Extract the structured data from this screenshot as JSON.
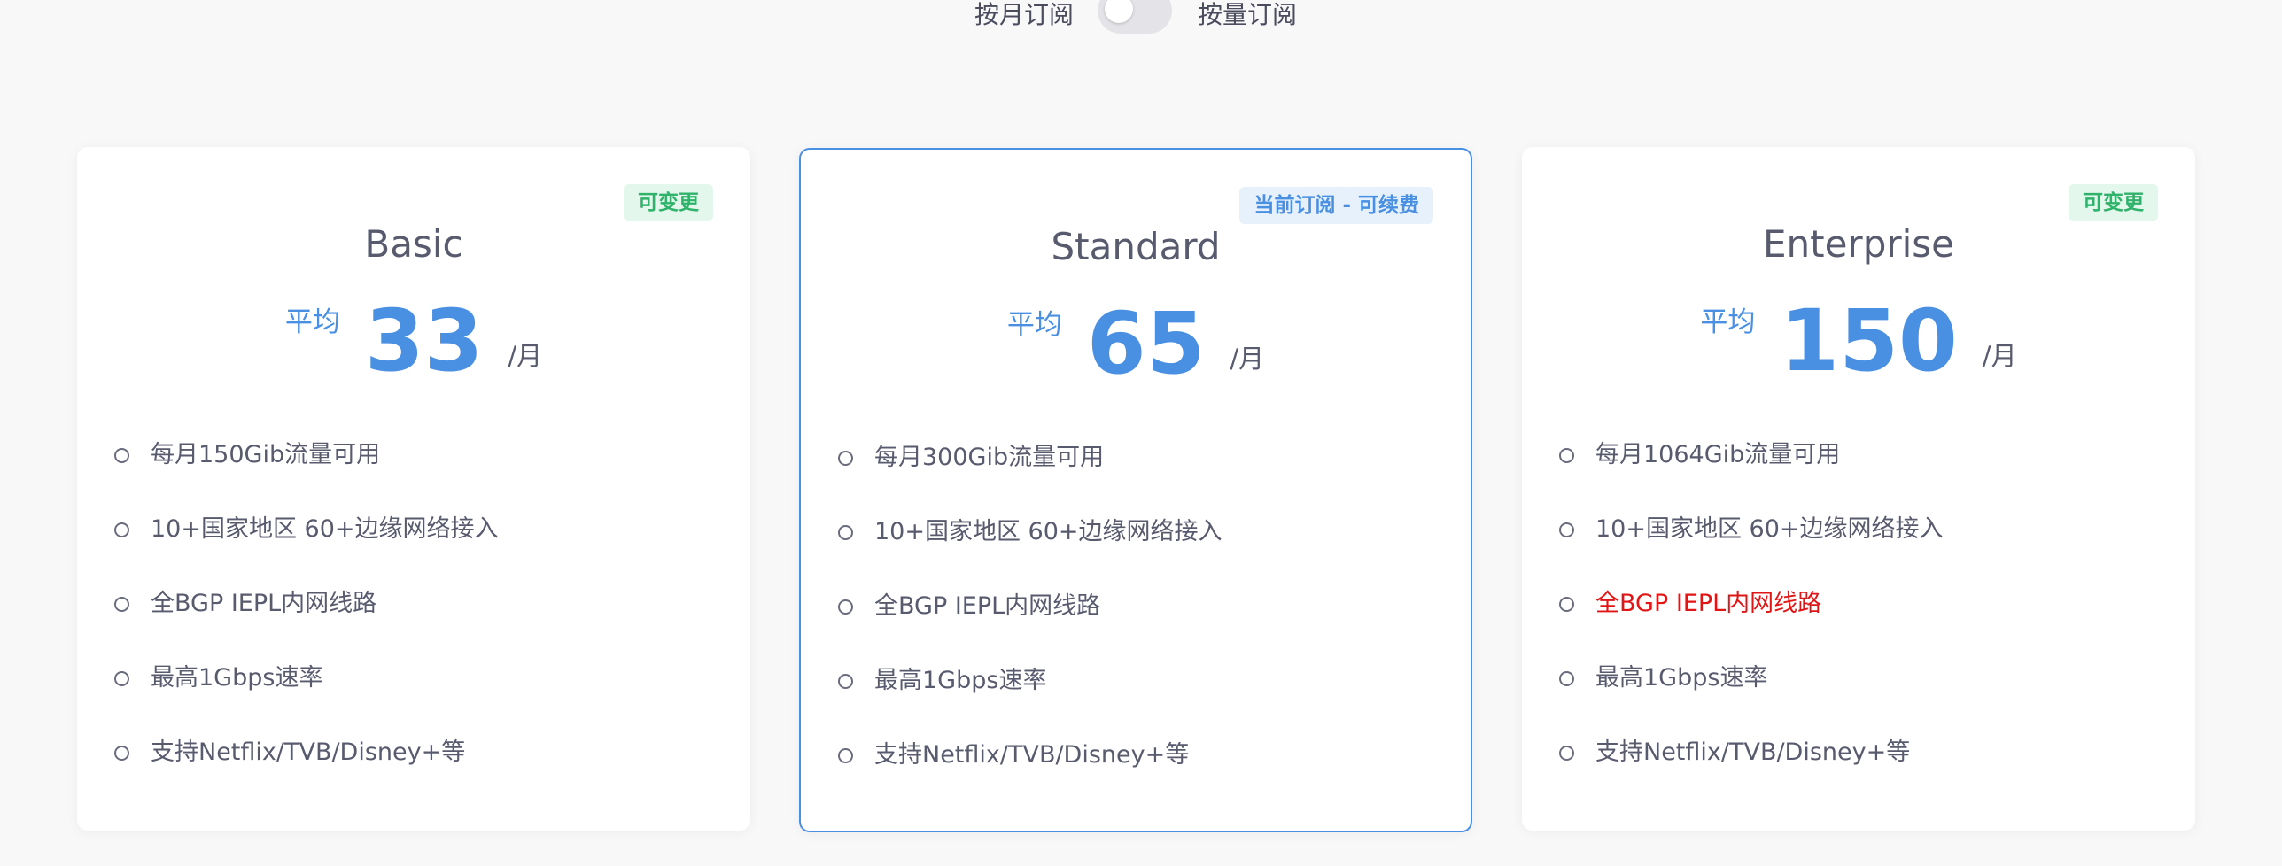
{
  "billing_toggle": {
    "monthly_label": "按月订阅",
    "usage_label": "按量订阅",
    "selected": "monthly"
  },
  "plans": [
    {
      "name": "Basic",
      "badge": "可变更",
      "price_prefix": "平均",
      "price": "33",
      "price_unit": "/月",
      "current": false,
      "features": [
        "每月150Gib流量可用",
        "10+国家地区 60+边缘网络接入",
        "全BGP IEPL内网线路",
        "最高1Gbps速率",
        "支持Netflix/TVB/Disney+等"
      ]
    },
    {
      "name": "Standard",
      "badge": "当前订阅 - 可续费",
      "price_prefix": "平均",
      "price": "65",
      "price_unit": "/月",
      "current": true,
      "features": [
        "每月300Gib流量可用",
        "10+国家地区 60+边缘网络接入",
        "全BGP IEPL内网线路",
        "最高1Gbps速率",
        "支持Netflix/TVB/Disney+等"
      ]
    },
    {
      "name": "Enterprise",
      "badge": "可变更",
      "price_prefix": "平均",
      "price": "150",
      "price_unit": "/月",
      "current": false,
      "features": [
        "每月1064Gib流量可用",
        "10+国家地区 60+边缘网络接入",
        "全BGP IEPL内网线路",
        "最高1Gbps速率",
        "支持Netflix/TVB/Disney+等"
      ],
      "highlighted_feature": 2
    }
  ],
  "colors": {
    "accent": "#4a90e2",
    "badge_green": "#2fb36b",
    "badge_green_bg": "#e3f7ec",
    "badge_blue_bg": "#e6f1fc",
    "highlight_red": "#e01515",
    "text": "#585a6e",
    "background": "#f8f8f8"
  },
  "icons": {
    "feature": "circle-outline-icon"
  }
}
